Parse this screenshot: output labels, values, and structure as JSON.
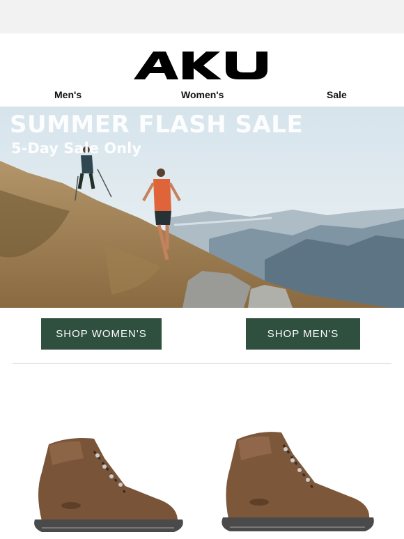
{
  "brand": {
    "logo_text": "AKU"
  },
  "nav": {
    "items": [
      "Men's",
      "Women's",
      "Sale"
    ]
  },
  "hero": {
    "title": "SUMMER FLASH SALE",
    "subtitle": "5-Day Sale Only"
  },
  "buttons": {
    "shop_women": "SHOP WOMEN'S",
    "shop_men": "SHOP MEN'S"
  },
  "colors": {
    "button_bg": "#2f4f3f",
    "boot_brown": "#7a5438",
    "sole_grey": "#4a4a4a"
  },
  "icons": {
    "logo": "aku-logo",
    "product_left": "hiking-boot-icon",
    "product_right": "hiking-boot-icon"
  }
}
